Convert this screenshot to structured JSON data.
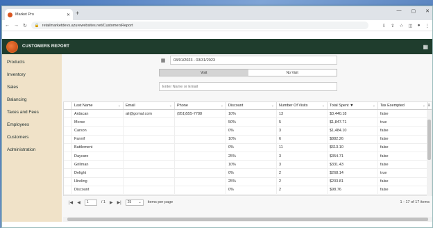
{
  "browser": {
    "tab_title": "Market Pro",
    "tab_close": "✕",
    "new_tab": "+",
    "url": "retailmarketdevs.azurewebsites.net/CustomersReport",
    "win_min": "—",
    "win_max": "▢",
    "win_close": "✕"
  },
  "app": {
    "title": "CUSTOMERS REPORT",
    "accent": "#1f3d2d"
  },
  "sidebar": {
    "items": [
      {
        "label": "Products"
      },
      {
        "label": "Inventory"
      },
      {
        "label": "Sales"
      },
      {
        "label": "Balancing"
      },
      {
        "label": "Taxes and Fees"
      },
      {
        "label": "Employees"
      },
      {
        "label": "Customers"
      },
      {
        "label": "Administration"
      }
    ]
  },
  "filters": {
    "date_range": "03/01/2023 - 03/31/2023",
    "toggle": [
      "Visit",
      "No Visit"
    ],
    "search_placeholder": "Enter Name or Email"
  },
  "table": {
    "columns": [
      "Last Name",
      "Email",
      "Phone",
      "Discount",
      "Number Of Visits",
      "Total Spent",
      "Tax Exempted"
    ],
    "sort_indicator": "▼",
    "rows": [
      [
        "Ardacan",
        "ali@gomal.com",
        "(951)555-7788",
        "10%",
        "13",
        "$3,440.18",
        "false"
      ],
      [
        "Morse",
        "",
        "",
        "50%",
        "5",
        "$1,847.71",
        "true"
      ],
      [
        "Carson",
        "",
        "",
        "0%",
        "3",
        "$1,484.10",
        "false"
      ],
      [
        "Fannif",
        "",
        "",
        "10%",
        "6",
        "$882.26",
        "false"
      ],
      [
        "Battlement",
        "",
        "",
        "0%",
        "11",
        "$613.10",
        "false"
      ],
      [
        "Daycare",
        "",
        "",
        "25%",
        "3",
        "$354.71",
        "false"
      ],
      [
        "Grillman",
        "",
        "",
        "10%",
        "3",
        "$331.43",
        "false"
      ],
      [
        "Delight",
        "",
        "",
        "0%",
        "2",
        "$268.14",
        "true"
      ],
      [
        "Hireling",
        "",
        "",
        "25%",
        "2",
        "$203.81",
        "false"
      ],
      [
        "Discount",
        "",
        "",
        "0%",
        "2",
        "$98.76",
        "false"
      ]
    ]
  },
  "pager": {
    "page": "1",
    "of_pages": "/ 1",
    "page_size": "25",
    "per_page_label": "items per page",
    "info": "1 - 17 of 17 items"
  }
}
